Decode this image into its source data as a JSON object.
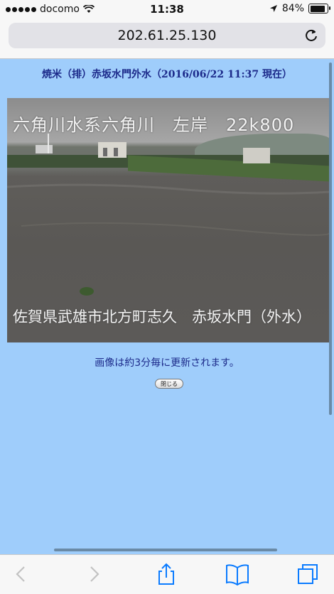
{
  "status_bar": {
    "carrier": "docomo",
    "time": "11:38",
    "battery": "84%"
  },
  "url_bar": {
    "url": "202.61.25.130"
  },
  "page": {
    "title": "焼米（排）赤坂水門外水（2016/06/22 11:37 現在）",
    "camera": {
      "top_label": "六角川水系六角川　左岸　22k800",
      "bottom_label": "佐賀県武雄市北方町志久　赤坂水門（外水）"
    },
    "note": "画像は約3分毎に更新されます。",
    "close_button": "閉じる"
  },
  "colors": {
    "background": "#9fcdfb",
    "title_text": "#1d2b8b",
    "accent": "#0a7bff"
  }
}
